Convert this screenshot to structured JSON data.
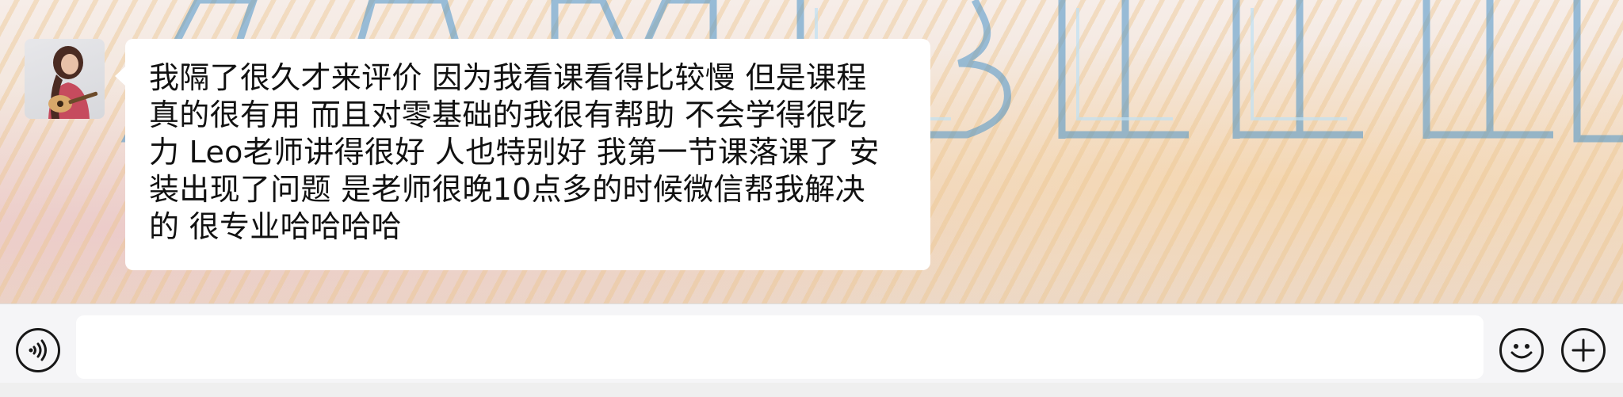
{
  "chat": {
    "messages": [
      {
        "sender": "other",
        "avatar_icon": "avatar-girl-with-ukulele",
        "text": "我隔了很久才来评价 因为我看课看得比较慢 但是课程\n真的很有用 而且对零基础的我很有帮助 不会学得很吃\n力 Leo老师讲得很好 人也特别好 我第一节课落课了 安\n装出现了问题 是老师很晚10点多的时候微信帮我解决\n的 很专业哈哈哈哈"
      }
    ]
  },
  "input_bar": {
    "voice_icon": "voice-icon",
    "input_value": "",
    "emoji_icon": "emoji-icon",
    "more_icon": "plus-icon"
  },
  "colors": {
    "bubble": "#ffffff",
    "input_bar": "#f5f5f7",
    "icon": "#181818",
    "wallpaper_accent": "#3e8fc9"
  }
}
